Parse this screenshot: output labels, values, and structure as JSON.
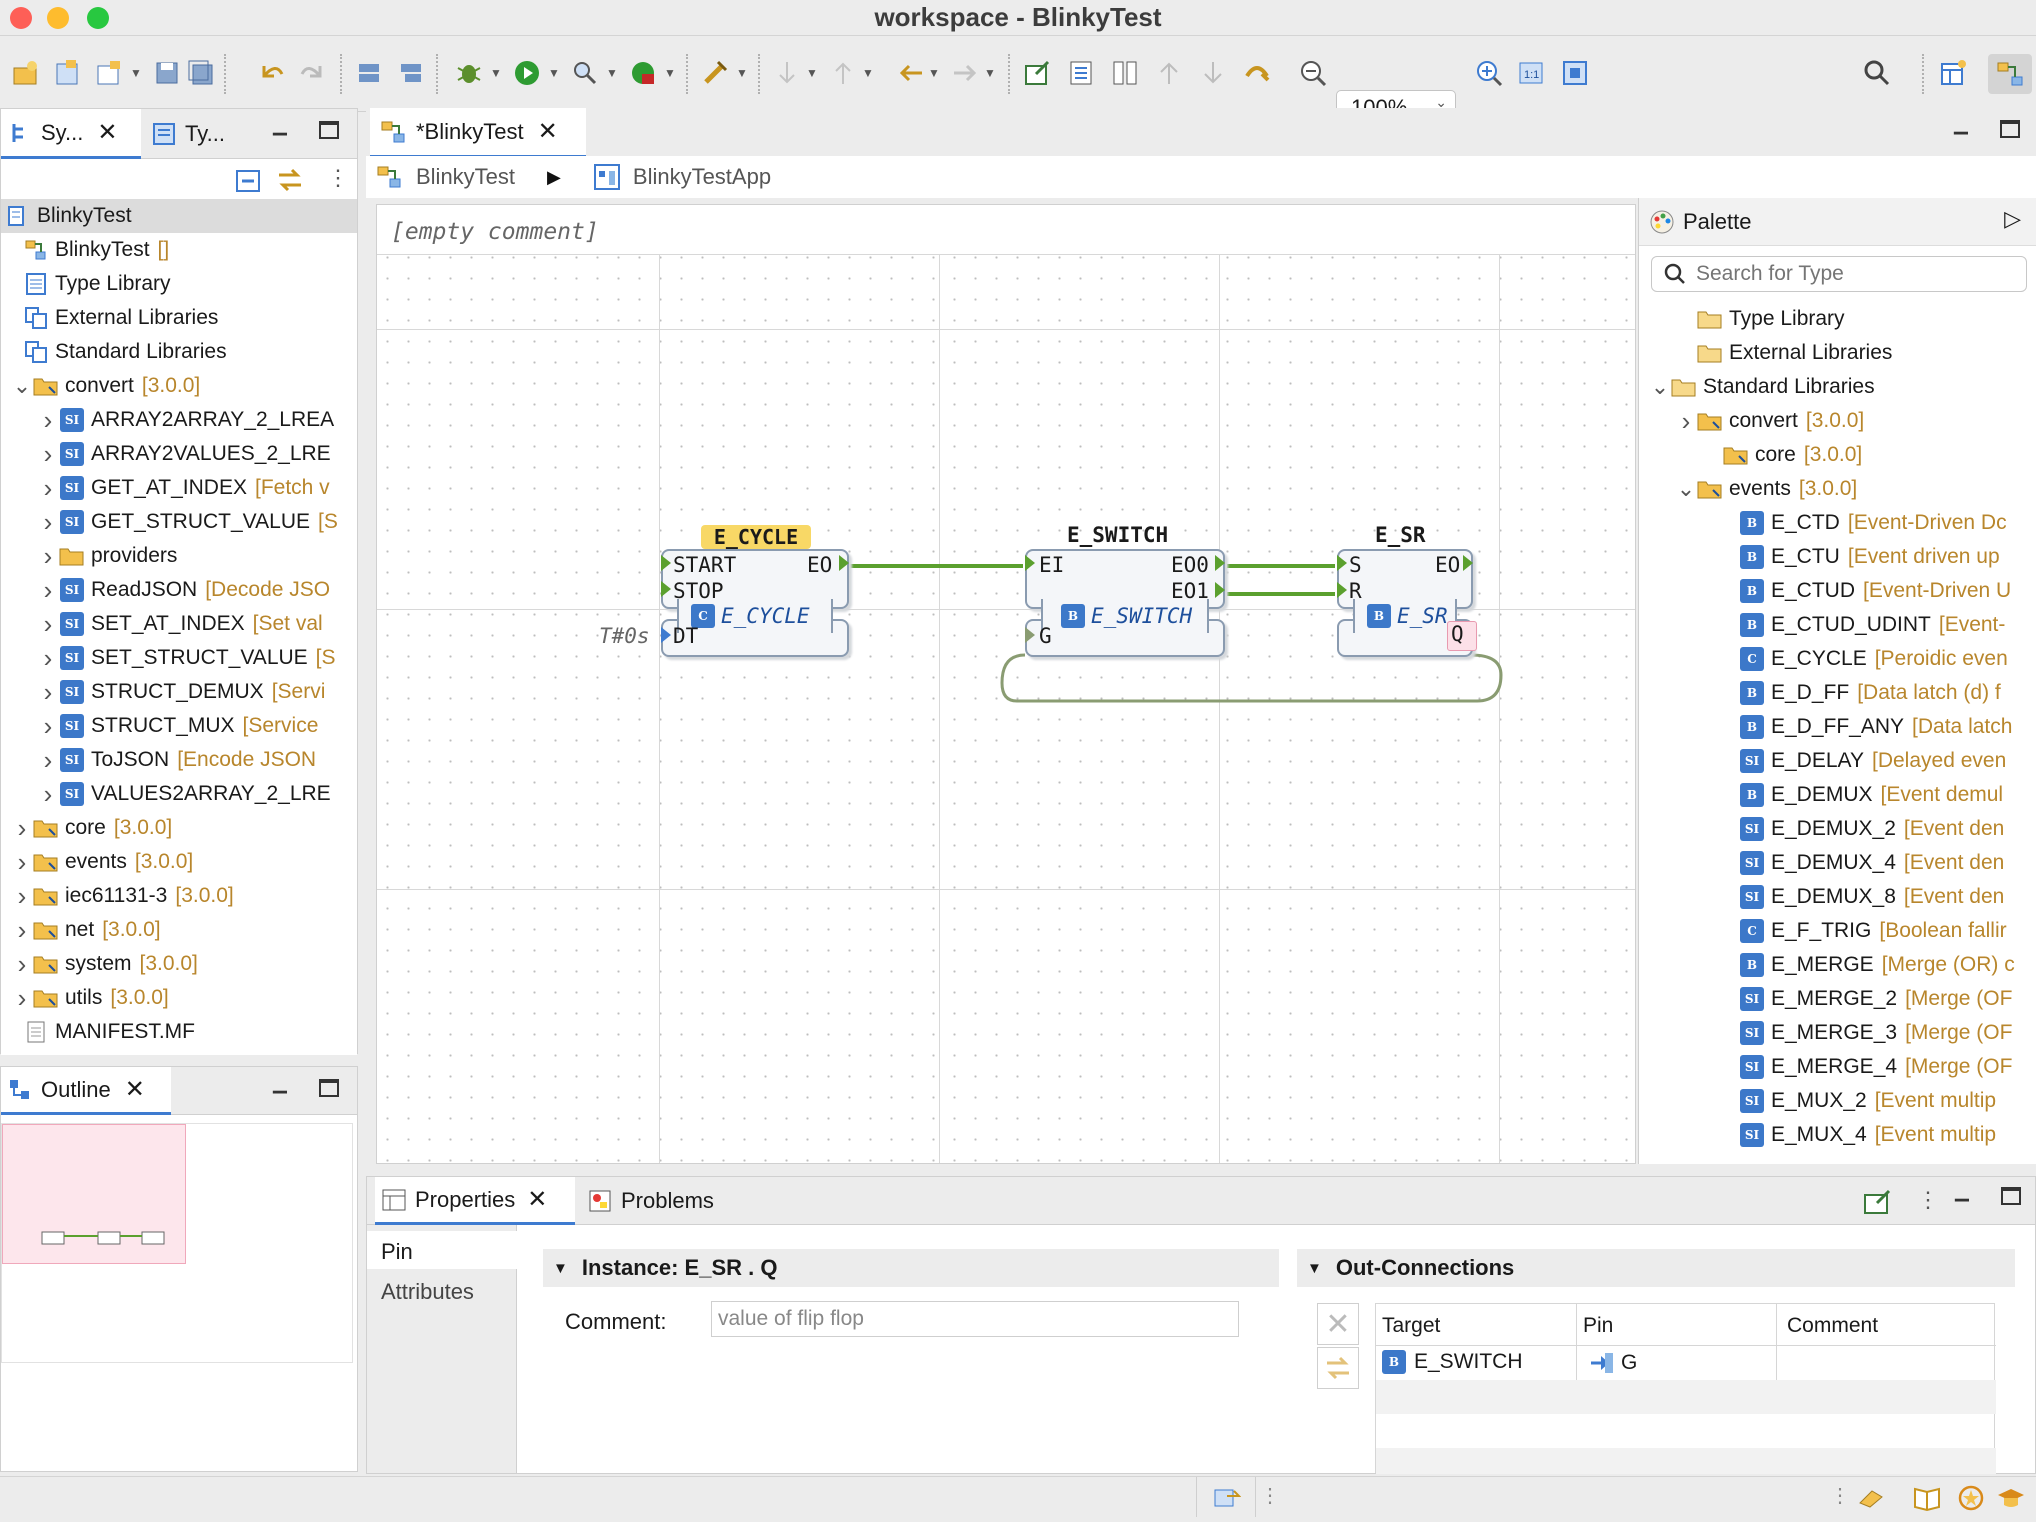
{
  "window": {
    "title": "workspace - BlinkyTest"
  },
  "toolbar": {
    "zoom": "100%",
    "zoom_icon_labels": {
      "fit": "1:1"
    }
  },
  "left_top_panel": {
    "tabs": [
      {
        "label": "Sy..."
      },
      {
        "label": "Ty..."
      }
    ],
    "tree": {
      "root": "BlinkyTest",
      "items": [
        {
          "label": "BlinkyTest",
          "tag": "[]",
          "icon": "system-icon"
        },
        {
          "label": "Type Library",
          "tag": "",
          "icon": "library-icon"
        },
        {
          "label": "External Libraries",
          "tag": "",
          "icon": "libraries-icon"
        },
        {
          "label": "Standard Libraries",
          "tag": "",
          "icon": "libraries-icon"
        }
      ],
      "convert": {
        "label": "convert",
        "tag": "[3.0.0]"
      },
      "convert_children": [
        {
          "label": "ARRAY2ARRAY_2_LREA",
          "tag": "",
          "icon": "SI"
        },
        {
          "label": "ARRAY2VALUES_2_LRE",
          "tag": "",
          "icon": "SI"
        },
        {
          "label": "GET_AT_INDEX",
          "tag": "[Fetch v",
          "icon": "SI"
        },
        {
          "label": "GET_STRUCT_VALUE",
          "tag": "[S",
          "icon": "SI"
        },
        {
          "label": "providers",
          "tag": "",
          "icon": "folder"
        },
        {
          "label": "ReadJSON",
          "tag": "[Decode JSO",
          "icon": "SI"
        },
        {
          "label": "SET_AT_INDEX",
          "tag": "[Set val",
          "icon": "SI"
        },
        {
          "label": "SET_STRUCT_VALUE",
          "tag": "[S",
          "icon": "SI"
        },
        {
          "label": "STRUCT_DEMUX",
          "tag": "[Servi",
          "icon": "SI"
        },
        {
          "label": "STRUCT_MUX",
          "tag": "[Service",
          "icon": "SI"
        },
        {
          "label": "ToJSON",
          "tag": "[Encode JSON",
          "icon": "SI"
        },
        {
          "label": "VALUES2ARRAY_2_LRE",
          "tag": "",
          "icon": "SI"
        }
      ],
      "libs": [
        {
          "label": "core",
          "tag": "[3.0.0]"
        },
        {
          "label": "events",
          "tag": "[3.0.0]"
        },
        {
          "label": "iec61131-3",
          "tag": "[3.0.0]"
        },
        {
          "label": "net",
          "tag": "[3.0.0]"
        },
        {
          "label": "system",
          "tag": "[3.0.0]"
        },
        {
          "label": "utils",
          "tag": "[3.0.0]"
        }
      ],
      "manifest": "MANIFEST.MF"
    }
  },
  "outline": {
    "tab": "Outline"
  },
  "editor": {
    "tab": "*BlinkyTest",
    "breadcrumb": [
      "BlinkyTest",
      "BlinkyTestApp"
    ],
    "comment": "[empty comment]",
    "blocks": {
      "cycle": {
        "name": "E_CYCLE",
        "type": "E_CYCLE",
        "type_icon": "C",
        "events_in": [
          "START",
          "STOP"
        ],
        "events_out": [
          "EO"
        ],
        "data_in": [
          "DT"
        ],
        "dt_value": "T#0s"
      },
      "switch": {
        "name": "E_SWITCH",
        "type": "E_SWITCH",
        "type_icon": "B",
        "events_in": [
          "EI"
        ],
        "events_out": [
          "EO0",
          "EO1"
        ],
        "data_in": [
          "G"
        ]
      },
      "sr": {
        "name": "E_SR",
        "type": "E_SR",
        "type_icon": "B",
        "events_in": [
          "S",
          "R"
        ],
        "events_out": [
          "EO"
        ],
        "data_out": [
          "Q"
        ]
      }
    }
  },
  "palette": {
    "title": "Palette",
    "search_placeholder": "Search for Type",
    "items": [
      {
        "label": "Type Library",
        "tag": ""
      },
      {
        "label": "External Libraries",
        "tag": ""
      },
      {
        "label": "Standard Libraries",
        "tag": ""
      },
      {
        "label": "convert",
        "tag": "[3.0.0]"
      },
      {
        "label": "core",
        "tag": "[3.0.0]"
      },
      {
        "label": "events",
        "tag": "[3.0.0]"
      }
    ],
    "events": [
      {
        "label": "E_CTD",
        "tag": "[Event-Driven Dc",
        "icon": "B"
      },
      {
        "label": "E_CTU",
        "tag": "[Event driven up",
        "icon": "B"
      },
      {
        "label": "E_CTUD",
        "tag": "[Event-Driven U",
        "icon": "B"
      },
      {
        "label": "E_CTUD_UDINT",
        "tag": "[Event-",
        "icon": "B"
      },
      {
        "label": "E_CYCLE",
        "tag": "[Peroidic even",
        "icon": "C"
      },
      {
        "label": "E_D_FF",
        "tag": "[Data latch (d) f",
        "icon": "B"
      },
      {
        "label": "E_D_FF_ANY",
        "tag": "[Data latch",
        "icon": "B"
      },
      {
        "label": "E_DELAY",
        "tag": "[Delayed even",
        "icon": "SI"
      },
      {
        "label": "E_DEMUX",
        "tag": "[Event demul",
        "icon": "B"
      },
      {
        "label": "E_DEMUX_2",
        "tag": "[Event den",
        "icon": "SI"
      },
      {
        "label": "E_DEMUX_4",
        "tag": "[Event den",
        "icon": "SI"
      },
      {
        "label": "E_DEMUX_8",
        "tag": "[Event den",
        "icon": "SI"
      },
      {
        "label": "E_F_TRIG",
        "tag": "[Boolean fallir",
        "icon": "C"
      },
      {
        "label": "E_MERGE",
        "tag": "[Merge (OR) c",
        "icon": "B"
      },
      {
        "label": "E_MERGE_2",
        "tag": "[Merge (OF",
        "icon": "SI"
      },
      {
        "label": "E_MERGE_3",
        "tag": "[Merge (OF",
        "icon": "SI"
      },
      {
        "label": "E_MERGE_4",
        "tag": "[Merge (OF",
        "icon": "SI"
      },
      {
        "label": "E_MUX_2",
        "tag": "[Event multip",
        "icon": "SI"
      },
      {
        "label": "E_MUX_4",
        "tag": "[Event multip",
        "icon": "SI"
      }
    ]
  },
  "bottom": {
    "tabs": [
      {
        "label": "Properties"
      },
      {
        "label": "Problems"
      }
    ],
    "side_tabs": [
      "Pin",
      "Attributes"
    ],
    "instance_title": "Instance: E_SR . Q",
    "comment_label": "Comment:",
    "comment_value": "value of flip flop",
    "out_title": "Out-Connections",
    "columns": [
      "Target",
      "Pin",
      "Comment"
    ],
    "rows": [
      {
        "target": "E_SWITCH",
        "pin": "G",
        "comment": ""
      }
    ]
  }
}
